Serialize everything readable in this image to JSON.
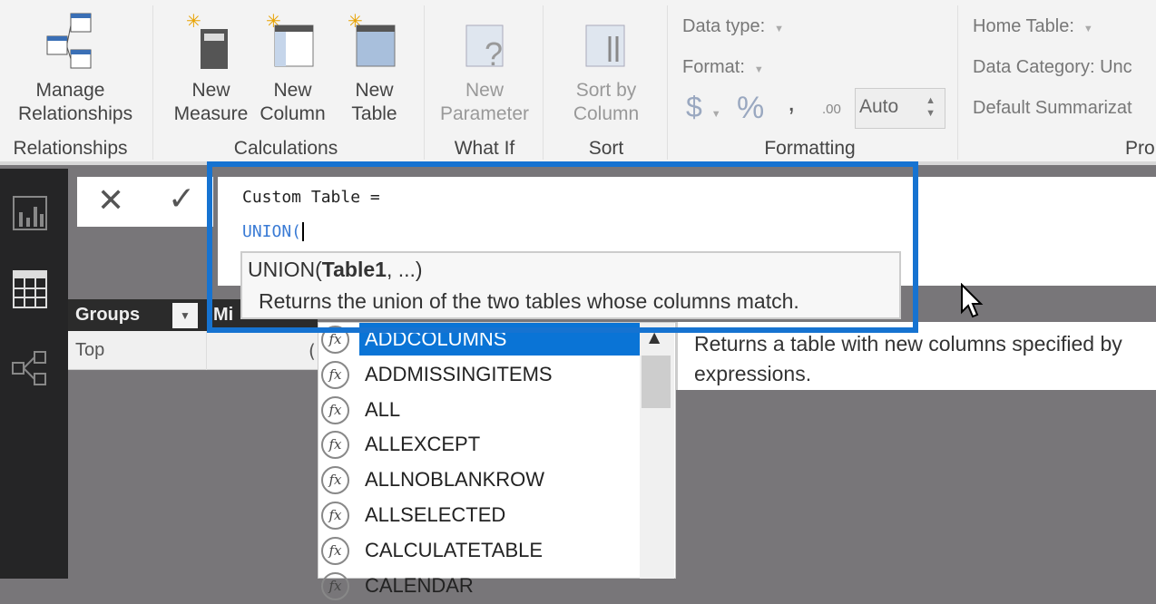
{
  "ribbon": {
    "buttons": {
      "manage_relationships": "Manage Relationships",
      "new_measure": "New Measure",
      "new_column": "New Column",
      "new_table": "New Table",
      "new_parameter": "New Parameter",
      "sort_by_column": "Sort by Column"
    },
    "groups": {
      "relationships": "Relationships",
      "calculations": "Calculations",
      "what_if": "What If",
      "sort": "Sort",
      "formatting": "Formatting",
      "properties": "Pro"
    },
    "formatting": {
      "data_type": "Data type:",
      "format": "Format:",
      "currency": "$",
      "percent": "%",
      "comma": ",",
      "decimals": ".00",
      "auto": "Auto"
    },
    "properties": {
      "home_table": "Home Table:",
      "data_category": "Data Category: Unc",
      "default_summarization": "Default Summarizat"
    }
  },
  "formula": {
    "line1": "Custom Table =",
    "line2": "UNION(",
    "cancel": "✕",
    "commit": "✓"
  },
  "signature": {
    "func": "UNION(",
    "param": "Table1",
    ", rest": ", ...)",
    "rest": ", ...)",
    "description": "Returns the union of the two tables whose columns match."
  },
  "table": {
    "headers": [
      "Groups",
      "Mi"
    ],
    "rows": [
      [
        "Top",
        "("
      ]
    ]
  },
  "autocomplete": {
    "items": [
      "ADDCOLUMNS",
      "ADDMISSINGITEMS",
      "ALL",
      "ALLEXCEPT",
      "ALLNOBLANKROW",
      "ALLSELECTED",
      "CALCULATETABLE",
      "CALENDAR"
    ],
    "selected": "ADDCOLUMNS",
    "icon": "fx",
    "description": "Returns a table with new columns specified by expressions."
  },
  "colors": {
    "accent": "#1673d1",
    "selection": "#0a74d6",
    "sidebar": "#252526"
  }
}
